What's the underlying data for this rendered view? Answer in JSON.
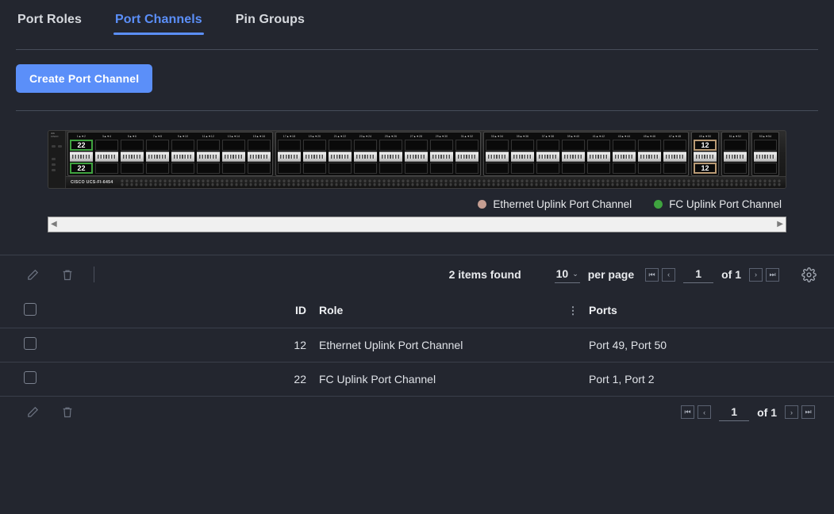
{
  "tabs": [
    {
      "label": "Port Roles",
      "active": false
    },
    {
      "label": "Port Channels",
      "active": true
    },
    {
      "label": "Pin Groups",
      "active": false
    }
  ],
  "toolbar_top": {
    "create_button": "Create Port Channel"
  },
  "switch": {
    "brand": "CISCO UCS-FI-6454",
    "port_labels": [
      "1▲▼2",
      "3▲▼4",
      "5▲▼6",
      "7▲▼8",
      "9▲▼10",
      "11▲▼12",
      "13▲▼14",
      "15▲▼16",
      "17▲▼18",
      "19▲▼20",
      "21▲▼22",
      "23▲▼24",
      "25▲▼26",
      "27▲▼28",
      "29▲▼30",
      "31▲▼32",
      "33▲▼34",
      "35▲▼36",
      "37▲▼38",
      "39▲▼40",
      "41▲▼42",
      "43▲▼44",
      "45▲▼46",
      "47▲▼48",
      "49▲▼50",
      "51▲▼52",
      "53▲▼54"
    ],
    "highlights": [
      {
        "port_pair": "1▲▼2",
        "badge": "22",
        "color": "#3fa33f",
        "type": "fc-uplink"
      },
      {
        "port_pair": "49▲▼50",
        "badge": "12",
        "color": "#b99a74",
        "type": "ethernet-uplink"
      }
    ]
  },
  "legend": [
    {
      "label": "Ethernet Uplink Port Channel",
      "color": "#c59e92"
    },
    {
      "label": "FC Uplink Port Channel",
      "color": "#3fa33f"
    }
  ],
  "scrollbar": {
    "left_arrow": "◀",
    "right_arrow": "▶"
  },
  "table_toolbar": {
    "edit_icon": "pencil-icon",
    "delete_icon": "trash-icon",
    "items_found": "2 items found",
    "page_size": "10",
    "caret": "⌄",
    "per_page_label": "per page",
    "first": "⏮",
    "prev": "‹",
    "page_number": "1",
    "of_pages": "of 1",
    "next": "›",
    "last": "⏭",
    "settings_icon": "gear-icon"
  },
  "table": {
    "columns": [
      "",
      "ID",
      "Role",
      "⋮",
      "Ports"
    ],
    "rows": [
      {
        "id": "12",
        "role": "Ethernet Uplink Port Channel",
        "ports": "Port 49, Port 50"
      },
      {
        "id": "22",
        "role": "FC Uplink Port Channel",
        "ports": "Port 1, Port 2"
      }
    ]
  },
  "footer_pager": {
    "first": "⏮",
    "prev": "‹",
    "page_number": "1",
    "of_pages": "of 1",
    "next": "›",
    "last": "⏭"
  }
}
